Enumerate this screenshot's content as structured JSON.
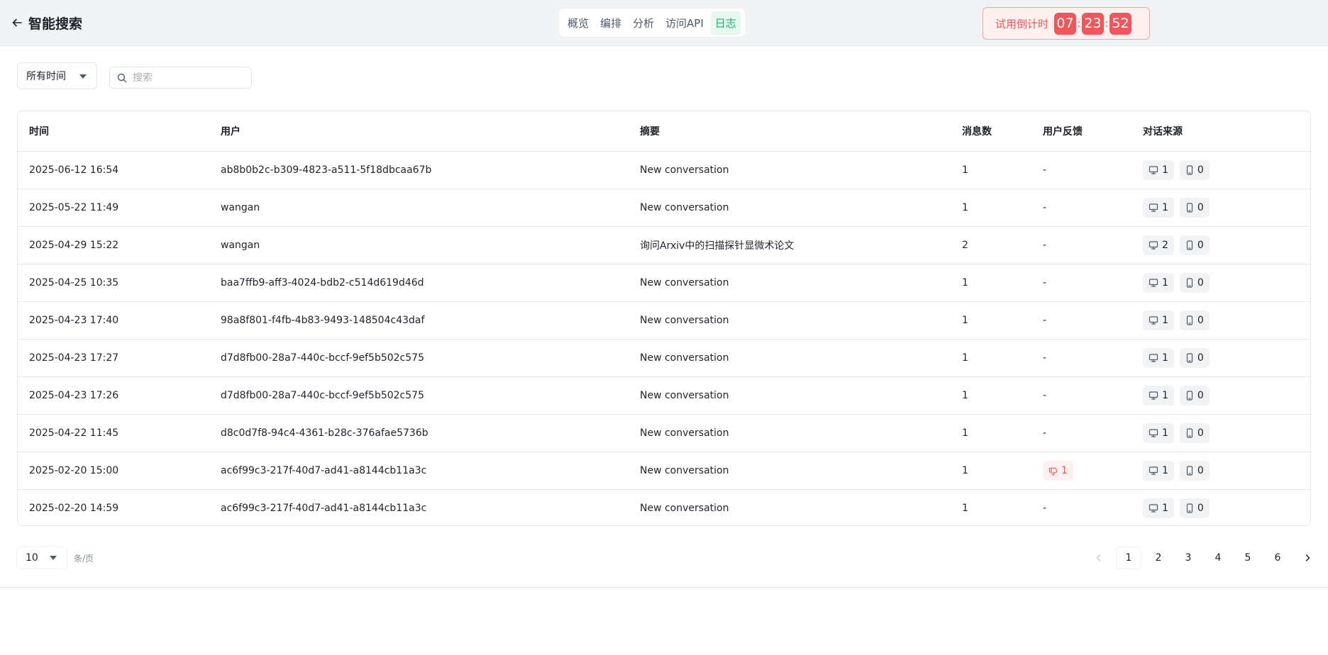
{
  "header": {
    "title": "智能搜索",
    "tabs": [
      {
        "label": "概览",
        "active": false
      },
      {
        "label": "编排",
        "active": false
      },
      {
        "label": "分析",
        "active": false
      },
      {
        "label": "访问API",
        "active": false
      },
      {
        "label": "日志",
        "active": true
      }
    ],
    "trial": {
      "label": "试用倒计时",
      "hours": "07",
      "minutes": "23",
      "seconds": "52"
    }
  },
  "filters": {
    "time_range": "所有时间",
    "search_placeholder": "搜索"
  },
  "table": {
    "columns": [
      "时间",
      "用户",
      "摘要",
      "消息数",
      "用户反馈",
      "对话来源"
    ],
    "rows": [
      {
        "time": "2025-06-12 16:54",
        "user": "ab8b0b2c-b309-4823-a511-5f18dbcaa67b",
        "summary": "New conversation",
        "messages": "1",
        "feedback": "-",
        "desktop": "1",
        "mobile": "0"
      },
      {
        "time": "2025-05-22 11:49",
        "user": "wangan",
        "summary": "New conversation",
        "messages": "1",
        "feedback": "-",
        "desktop": "1",
        "mobile": "0"
      },
      {
        "time": "2025-04-29 15:22",
        "user": "wangan",
        "summary": "询问Arxiv中的扫描探针显微术论文",
        "messages": "2",
        "feedback": "-",
        "desktop": "2",
        "mobile": "0"
      },
      {
        "time": "2025-04-25 10:35",
        "user": "baa7ffb9-aff3-4024-bdb2-c514d619d46d",
        "summary": "New conversation",
        "messages": "1",
        "feedback": "-",
        "desktop": "1",
        "mobile": "0"
      },
      {
        "time": "2025-04-23 17:40",
        "user": "98a8f801-f4fb-4b83-9493-148504c43daf",
        "summary": "New conversation",
        "messages": "1",
        "feedback": "-",
        "desktop": "1",
        "mobile": "0"
      },
      {
        "time": "2025-04-23 17:27",
        "user": "d7d8fb00-28a7-440c-bccf-9ef5b502c575",
        "summary": "New conversation",
        "messages": "1",
        "feedback": "-",
        "desktop": "1",
        "mobile": "0"
      },
      {
        "time": "2025-04-23 17:26",
        "user": "d7d8fb00-28a7-440c-bccf-9ef5b502c575",
        "summary": "New conversation",
        "messages": "1",
        "feedback": "-",
        "desktop": "1",
        "mobile": "0"
      },
      {
        "time": "2025-04-22 11:45",
        "user": "d8c0d7f8-94c4-4361-b28c-376afae5736b",
        "summary": "New conversation",
        "messages": "1",
        "feedback": "-",
        "desktop": "1",
        "mobile": "0"
      },
      {
        "time": "2025-02-20 15:00",
        "user": "ac6f99c3-217f-40d7-ad41-a8144cb11a3c",
        "summary": "New conversation",
        "messages": "1",
        "feedback": "dislike:1",
        "desktop": "1",
        "mobile": "0"
      },
      {
        "time": "2025-02-20 14:59",
        "user": "ac6f99c3-217f-40d7-ad41-a8144cb11a3c",
        "summary": "New conversation",
        "messages": "1",
        "feedback": "-",
        "desktop": "1",
        "mobile": "0"
      }
    ]
  },
  "pagination": {
    "page_size": "10",
    "per_page_label": "条/页",
    "pages": [
      "1",
      "2",
      "3",
      "4",
      "5",
      "6"
    ],
    "current": "1"
  },
  "colors": {
    "accent_green": "#12b76a",
    "trial_red": "#f2555a"
  },
  "icons": {
    "back": "arrow-left-icon",
    "search": "search-icon",
    "desktop": "monitor-icon",
    "mobile": "phone-icon",
    "dislike": "thumbs-down-icon"
  }
}
